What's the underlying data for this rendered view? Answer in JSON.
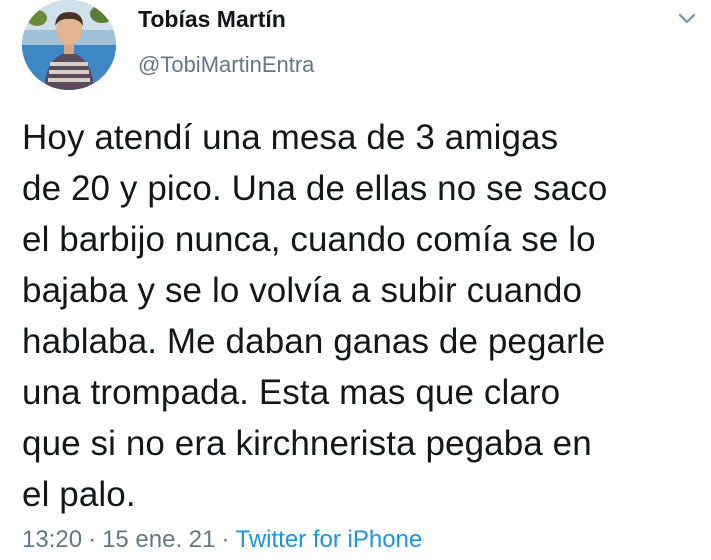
{
  "tweet": {
    "display_name": "Tobías Martín",
    "handle": "@TobiMartinEntra",
    "text": "Hoy atendí una mesa de 3 amigas\nde 20 y pico. Una de ellas no se saco\nel barbijo nunca, cuando comía se lo\nbajaba y se lo volvía a subir cuando\nhablaba. Me daban ganas de pegarle\nuna trompada. Esta mas que claro\nque si no era kirchnerista pegaba en\nel palo.",
    "time": "13:20",
    "date": "15 ene. 21",
    "separator": "·",
    "source": "Twitter for iPhone"
  },
  "icons": {
    "avatar": "avatar-photo",
    "more": "chevron-down-icon"
  },
  "colors": {
    "text": "#14171a",
    "secondary": "#657786",
    "link": "#1b95e0"
  }
}
